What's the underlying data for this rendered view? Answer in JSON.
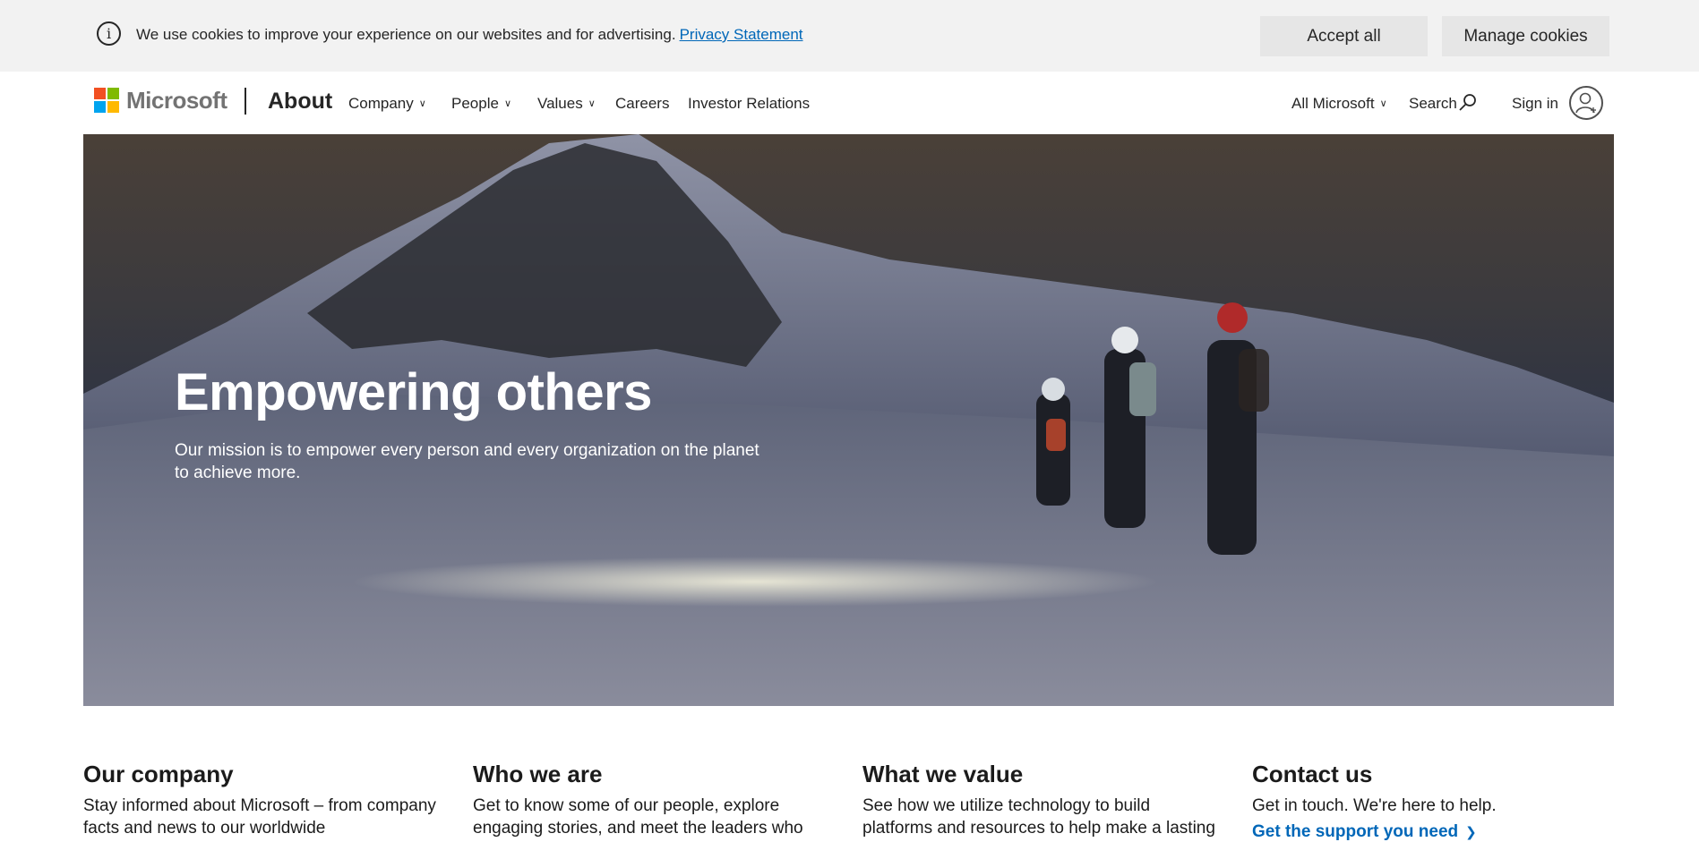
{
  "cookie_banner": {
    "message": "We use cookies to improve your experience on our websites and for advertising.",
    "privacy_link": "Privacy Statement",
    "accept_label": "Accept all",
    "manage_label": "Manage cookies"
  },
  "header": {
    "logo_text": "Microsoft",
    "site_title": "About",
    "nav": [
      {
        "label": "Company",
        "dropdown": true
      },
      {
        "label": "People",
        "dropdown": true
      },
      {
        "label": "Values",
        "dropdown": true
      },
      {
        "label": "Careers",
        "dropdown": false
      },
      {
        "label": "Investor Relations",
        "dropdown": false
      }
    ],
    "all_microsoft": "All Microsoft",
    "search_label": "Search",
    "sign_in": "Sign in"
  },
  "hero": {
    "title": "Empowering others",
    "subtitle": "Our mission is to empower every person and every organization on the planet to achieve more."
  },
  "cards": [
    {
      "title": "Our company",
      "text": "Stay informed about Microsoft – from company facts and news to our worldwide"
    },
    {
      "title": "Who we are",
      "text": "Get to know some of our people, explore engaging stories, and meet the leaders who"
    },
    {
      "title": "What we value",
      "text": "See how we utilize technology to build platforms and resources to help make a lasting"
    },
    {
      "title": "Contact us",
      "text": "Get in touch. We're here to help.",
      "link": "Get the support you need"
    }
  ],
  "colors": {
    "link_blue": "#0067b8",
    "banner_bg": "#f2f2f2",
    "logo_red": "#f25022",
    "logo_green": "#7fba00",
    "logo_blue": "#00a4ef",
    "logo_yellow": "#ffb900"
  },
  "icons": [
    "info-icon",
    "chevron-down-icon",
    "search-icon",
    "user-avatar-icon",
    "chevron-right-icon"
  ]
}
